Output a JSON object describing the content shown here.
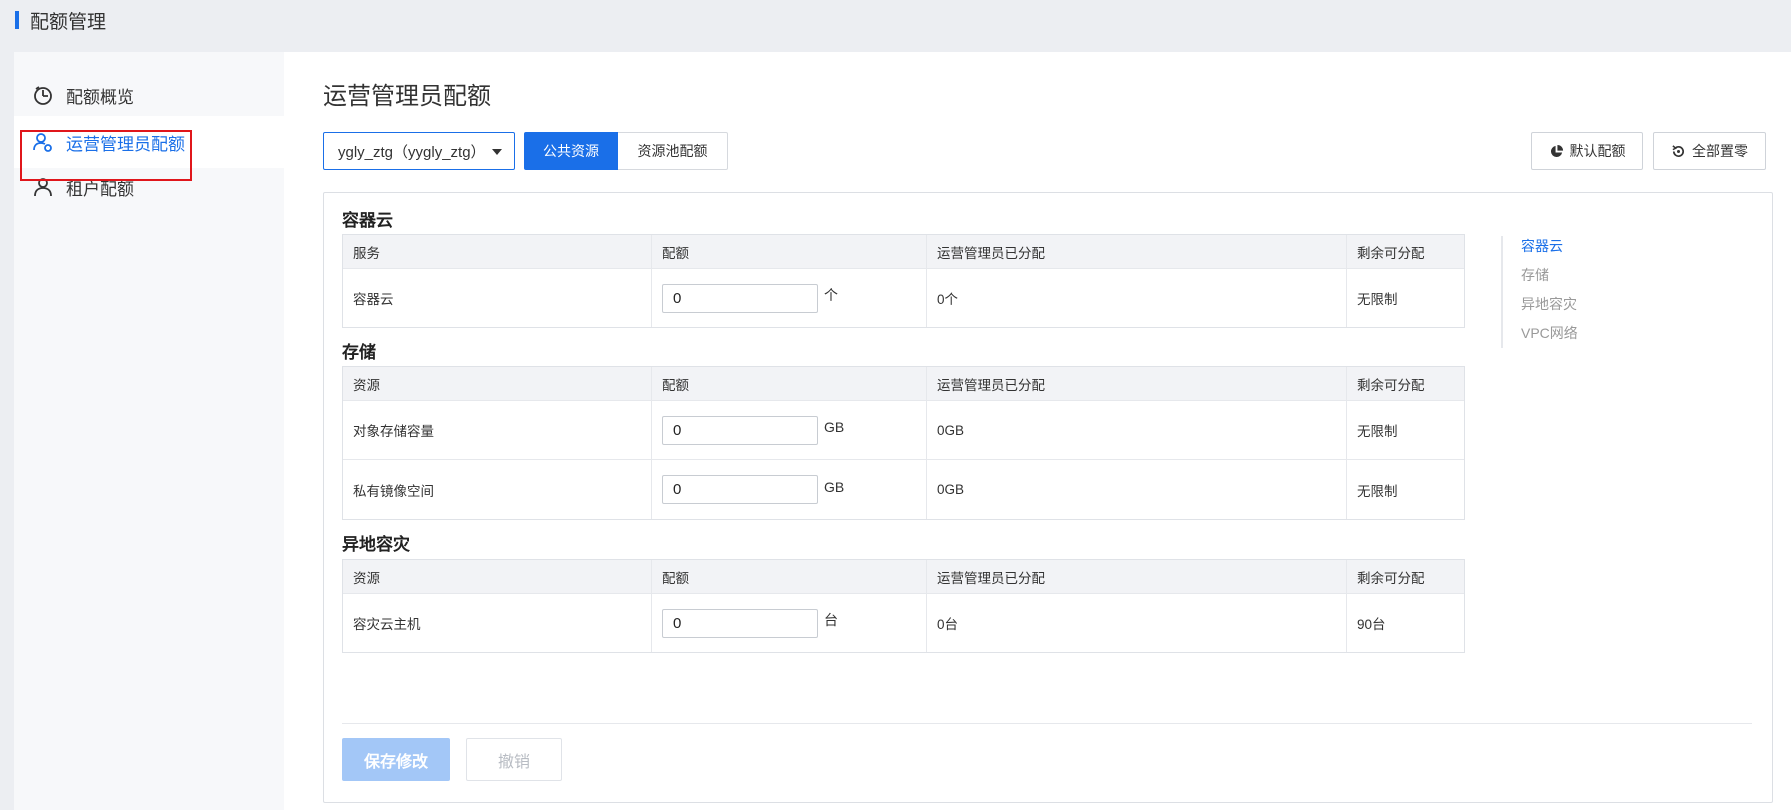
{
  "header": {
    "title": "配额管理"
  },
  "sidebar": {
    "items": [
      {
        "label": "配额概览",
        "icon": "pie-clock-icon"
      },
      {
        "label": "运营管理员配额",
        "icon": "user-gear-icon"
      },
      {
        "label": "租户配额",
        "icon": "user-icon"
      }
    ],
    "active_index": 1
  },
  "main": {
    "title": "运营管理员配额",
    "select": {
      "value": "ygly_ztg（yygly_ztg）"
    },
    "segments": {
      "public": "公共资源",
      "pool": "资源池配额"
    },
    "toolbar": {
      "default_label": "默认配额",
      "reset_label": "全部置零"
    },
    "sections": [
      {
        "title": "容器云",
        "headers": [
          "服务",
          "配额",
          "运营管理员已分配",
          "剩余可分配"
        ],
        "rows": [
          {
            "name": "容器云",
            "quota": "0",
            "unit": "个",
            "allocated": "0个",
            "remaining": "无限制"
          }
        ]
      },
      {
        "title": "存储",
        "headers": [
          "资源",
          "配额",
          "运营管理员已分配",
          "剩余可分配"
        ],
        "rows": [
          {
            "name": "对象存储容量",
            "quota": "0",
            "unit": "GB",
            "allocated": "0GB",
            "remaining": "无限制"
          },
          {
            "name": "私有镜像空间",
            "quota": "0",
            "unit": "GB",
            "allocated": "0GB",
            "remaining": "无限制"
          }
        ]
      },
      {
        "title": "异地容灾",
        "headers": [
          "资源",
          "配额",
          "运营管理员已分配",
          "剩余可分配"
        ],
        "rows": [
          {
            "name": "容灾云主机",
            "quota": "0",
            "unit": "台",
            "allocated": "0台",
            "remaining": "90台"
          }
        ]
      }
    ],
    "anchors": [
      "容器云",
      "存储",
      "异地容灾",
      "VPC网络"
    ],
    "actions": {
      "save_label": "保存修改",
      "cancel_label": "撤销"
    }
  },
  "colors": {
    "accent": "#1a6fe8",
    "highlight": "#e0161b",
    "save_disabled": "#a3c7f7"
  }
}
